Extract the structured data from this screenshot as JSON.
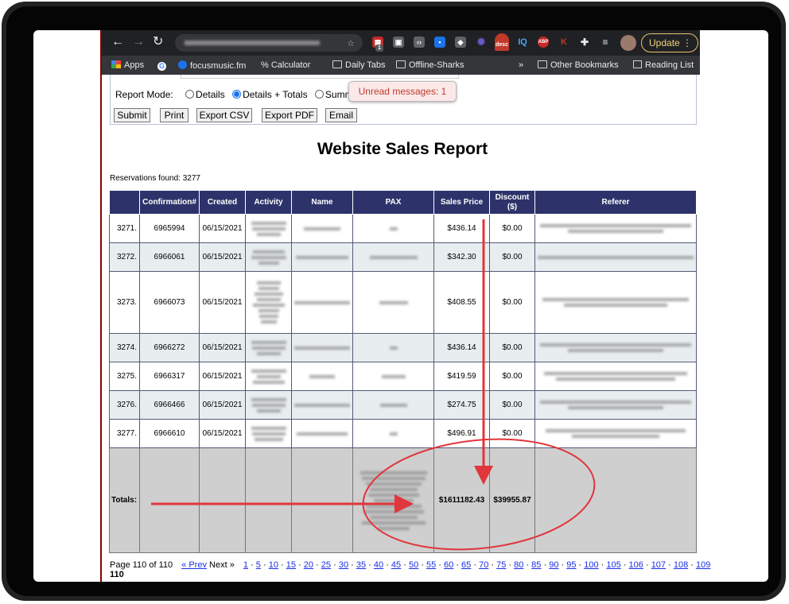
{
  "browser": {
    "update_label": "Update",
    "update_menu": "⋮",
    "ext_desc_label": "desc",
    "ext_badge": "1",
    "bookmarks": [
      {
        "label": "Apps"
      },
      {
        "label": "focusmusic.fm"
      },
      {
        "label": "% Calculator"
      },
      {
        "label": "Daily Tabs"
      },
      {
        "label": "Offline-Sharks"
      },
      {
        "label": "»"
      },
      {
        "label": "Other Bookmarks"
      },
      {
        "label": "Reading List"
      }
    ]
  },
  "form": {
    "report_mode_label": "Report Mode:",
    "mode_details": "Details",
    "mode_details_totals": "Details + Totals",
    "mode_summary_partial": "Summa",
    "buttons": {
      "submit": "Submit",
      "print": "Print",
      "export_csv": "Export CSV",
      "export_pdf": "Export PDF",
      "email": "Email"
    }
  },
  "notification": {
    "text": "Unread messages: 1"
  },
  "report": {
    "title": "Website Sales Report",
    "reservations_found": "Reservations found: 3277",
    "columns": [
      "",
      "Confirmation#",
      "Created",
      "Activity",
      "Name",
      "PAX",
      "Sales Price",
      "Discount ($)",
      "Referer"
    ],
    "rows": [
      {
        "index": "3271.",
        "confirmation": "6965994",
        "created": "06/15/2021",
        "sales_price": "$436.14",
        "discount": "$0.00"
      },
      {
        "index": "3272.",
        "confirmation": "6966061",
        "created": "06/15/2021",
        "sales_price": "$342.30",
        "discount": "$0.00"
      },
      {
        "index": "3273.",
        "confirmation": "6966073",
        "created": "06/15/2021",
        "sales_price": "$408.55",
        "discount": "$0.00"
      },
      {
        "index": "3274.",
        "confirmation": "6966272",
        "created": "06/15/2021",
        "sales_price": "$436.14",
        "discount": "$0.00"
      },
      {
        "index": "3275.",
        "confirmation": "6966317",
        "created": "06/15/2021",
        "sales_price": "$419.59",
        "discount": "$0.00"
      },
      {
        "index": "3276.",
        "confirmation": "6966466",
        "created": "06/15/2021",
        "sales_price": "$274.75",
        "discount": "$0.00"
      },
      {
        "index": "3277.",
        "confirmation": "6966610",
        "created": "06/15/2021",
        "sales_price": "$496.91",
        "discount": "$0.00"
      }
    ],
    "totals": {
      "label": "Totals:",
      "sales_price": "$1611182.43",
      "discount": "$39955.87"
    }
  },
  "pagination": {
    "summary": "Page 110 of 110",
    "prev": "« Prev",
    "next": "Next »",
    "pages": [
      "1",
      "5",
      "10",
      "15",
      "20",
      "25",
      "30",
      "35",
      "40",
      "45",
      "50",
      "55",
      "60",
      "65",
      "70",
      "75",
      "80",
      "85",
      "90",
      "95",
      "100",
      "105",
      "106",
      "107",
      "108",
      "109"
    ],
    "current": "110"
  },
  "annotation_color": "#e0363c"
}
